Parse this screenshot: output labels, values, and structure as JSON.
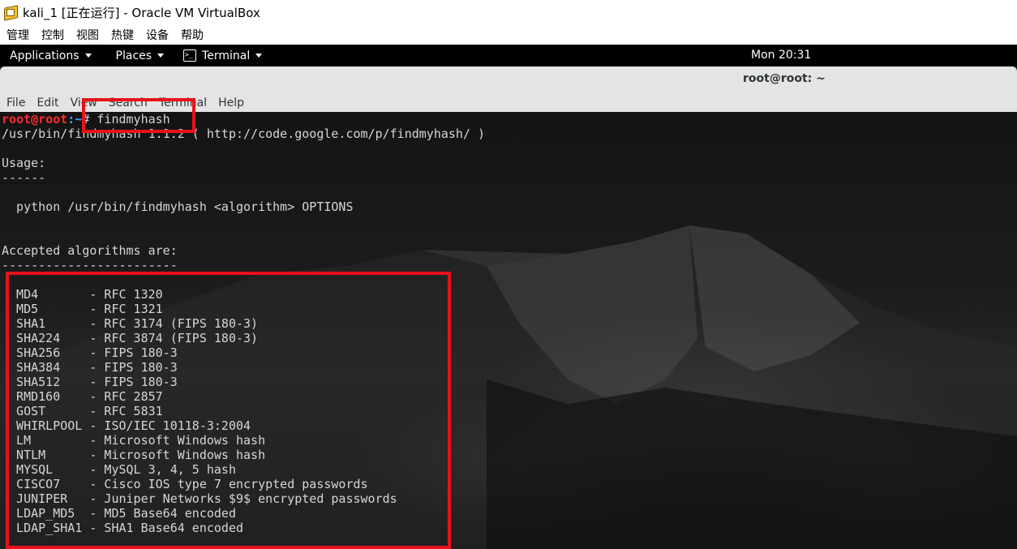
{
  "vbox": {
    "title": "kali_1 [正在运行] - Oracle VM VirtualBox",
    "menu": [
      "管理",
      "控制",
      "视图",
      "热键",
      "设备",
      "帮助"
    ]
  },
  "gnome": {
    "applications": "Applications",
    "places": "Places",
    "terminal": "Terminal",
    "clock": "Mon 20:31"
  },
  "terminal": {
    "title": "root@root: ~",
    "menu": [
      "File",
      "Edit",
      "View",
      "Search",
      "Terminal",
      "Help"
    ],
    "prompt_user": "root@root",
    "prompt_path": ":~",
    "prompt_symbol": "#",
    "command": " findmyhash",
    "lines": [
      "/usr/bin/findmyhash 1.1.2 ( http://code.google.com/p/findmyhash/ )",
      "",
      "Usage:",
      "------",
      "",
      "  python /usr/bin/findmyhash <algorithm> OPTIONS",
      "",
      "",
      "Accepted algorithms are:",
      "------------------------",
      "",
      "  MD4       - RFC 1320",
      "  MD5       - RFC 1321",
      "  SHA1      - RFC 3174 (FIPS 180-3)",
      "  SHA224    - RFC 3874 (FIPS 180-3)",
      "  SHA256    - FIPS 180-3",
      "  SHA384    - FIPS 180-3",
      "  SHA512    - FIPS 180-3",
      "  RMD160    - RFC 2857",
      "  GOST      - RFC 5831",
      "  WHIRLPOOL - ISO/IEC 10118-3:2004",
      "  LM        - Microsoft Windows hash",
      "  NTLM      - Microsoft Windows hash",
      "  MYSQL     - MySQL 3, 4, 5 hash",
      "  CISCO7    - Cisco IOS type 7 encrypted passwords",
      "  JUNIPER   - Juniper Networks $9$ encrypted passwords",
      "  LDAP_MD5  - MD5 Base64 encoded",
      "  LDAP_SHA1 - SHA1 Base64 encoded"
    ]
  },
  "colors": {
    "annotation_red": "#e8121a",
    "prompt_user": "#ff2b2b",
    "prompt_path": "#4aa3ff"
  }
}
